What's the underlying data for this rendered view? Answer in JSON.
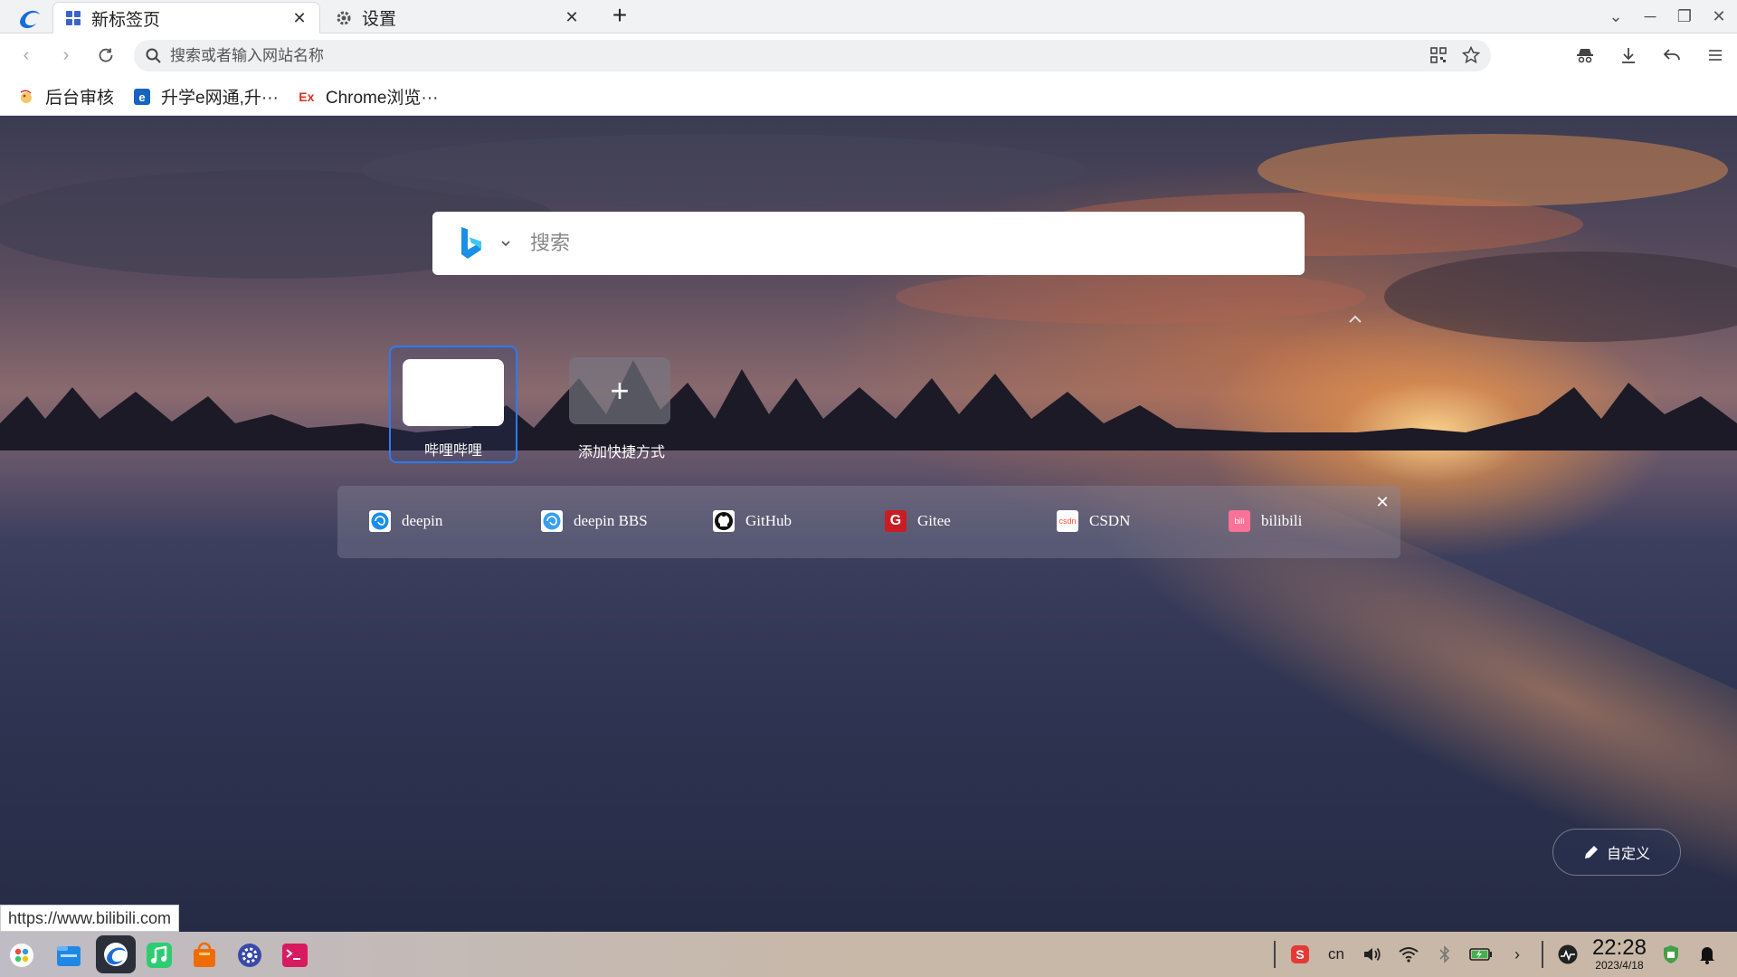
{
  "tabs": [
    {
      "label": "新标签页",
      "active": true
    },
    {
      "label": "设置",
      "active": false
    }
  ],
  "omnibox": {
    "placeholder": "搜索或者输入网站名称",
    "value": ""
  },
  "bookmarks": [
    {
      "label": "后台审核"
    },
    {
      "label": "升学e网通,升···"
    },
    {
      "label": "Chrome浏览···",
      "icon_text": "Ex"
    }
  ],
  "search": {
    "placeholder": "搜索",
    "engine": "bing"
  },
  "shortcuts": [
    {
      "label": "哔哩哔哩"
    },
    {
      "label": "添加快捷方式",
      "icon_text": "+"
    }
  ],
  "sites": [
    {
      "label": "deepin"
    },
    {
      "label": "deepin BBS"
    },
    {
      "label": "GitHub"
    },
    {
      "label": "Gitee",
      "icon_text": "G"
    },
    {
      "label": "CSDN",
      "icon_text": "csdn"
    },
    {
      "label": "bilibili",
      "icon_text": "bili"
    }
  ],
  "customize": {
    "label": "自定义"
  },
  "status_url": "https://www.bilibili.com",
  "tray": {
    "ime": "cn",
    "time": "22:28",
    "date": "2023/4/18"
  },
  "colors": {
    "accent": "#2a7cf6",
    "gitee": "#c71d23",
    "csdn": "#fc5531",
    "bilibili": "#fb7299"
  }
}
